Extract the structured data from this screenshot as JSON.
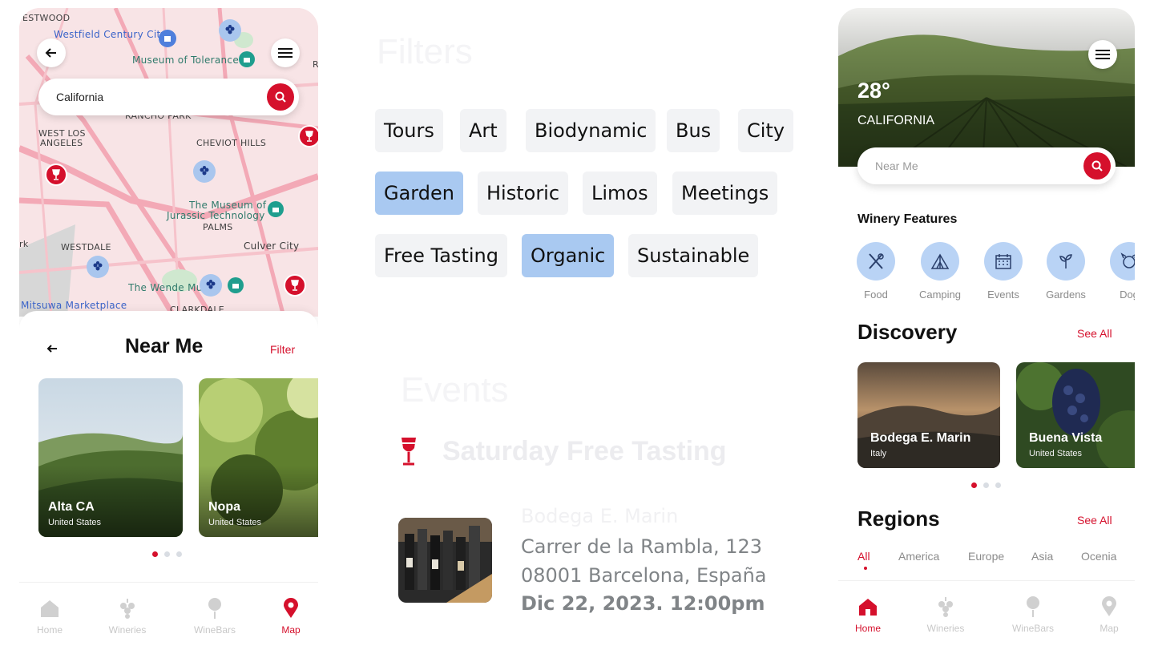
{
  "colors": {
    "accent": "#d5102c",
    "chip_selected": "#a9c9f1",
    "chip": "#f2f3f5",
    "feature_circle": "#b9d3f5"
  },
  "left_phone": {
    "map": {
      "search_value": "California",
      "labels": {
        "westwood": "ESTWOOD",
        "westfield": "Westfield Century City",
        "museum_tolerance": "Museum of Tolerance",
        "rancho_park": "RANCHO PARK",
        "west_la_1": "WEST LOS",
        "west_la_2": "ANGELES",
        "cheviot": "CHEVIOT HILLS",
        "jurassic_1": "The Museum of",
        "jurassic_2": "Jurassic Technology",
        "palms": "PALMS",
        "westdale": "WESTDALE",
        "culver": "Culver City",
        "rk": "rk",
        "wende": "The Wende Mu",
        "mitsuwa": "Mitsuwa Marketplace",
        "clarkdale": "CLARKDALE",
        "r_edge": "R"
      }
    },
    "sheet": {
      "title": "Near Me",
      "filter_label": "Filter",
      "cards": [
        {
          "title": "Alta CA",
          "subtitle": "United States"
        },
        {
          "title": "Nopa",
          "subtitle": "United States"
        }
      ]
    },
    "tabs": [
      {
        "label": "Home",
        "icon": "home-icon"
      },
      {
        "label": "Wineries",
        "icon": "grape-icon"
      },
      {
        "label": "WineBars",
        "icon": "wine-glass-pin-icon"
      },
      {
        "label": "Map",
        "icon": "map-pin-icon"
      }
    ]
  },
  "middle": {
    "filters_title": "Filters",
    "chips": [
      "Tours",
      "Art",
      "Biodynamic",
      "Bus",
      "City",
      "Garden",
      "Historic",
      "Limos",
      "Meetings",
      "Free Tasting",
      "Organic",
      "Sustainable"
    ],
    "selected_chips": [
      "Garden",
      "Organic"
    ],
    "events_title": "Events",
    "event": {
      "title": "Saturday Free Tasting",
      "venue": "Bodega E. Marin",
      "address1": "Carrer de la Rambla, 123",
      "address2": "08001 Barcelona, España",
      "datetime": "Dic 22, 2023. 12:00pm"
    }
  },
  "right_phone": {
    "temperature": "28°",
    "location": "CALIFORNIA",
    "search_placeholder": "Near Me",
    "features_title": "Winery Features",
    "features": [
      {
        "label": "Food",
        "icon": "utensils-icon"
      },
      {
        "label": "Camping",
        "icon": "tent-icon"
      },
      {
        "label": "Events",
        "icon": "calendar-icon"
      },
      {
        "label": "Gardens",
        "icon": "plant-icon"
      },
      {
        "label": "Dog",
        "icon": "dog-icon"
      }
    ],
    "discovery_title": "Discovery",
    "see_all": "See All",
    "discovery_cards": [
      {
        "title": "Bodega E. Marin",
        "subtitle": "Italy"
      },
      {
        "title": "Buena Vista",
        "subtitle": "United States"
      }
    ],
    "regions_title": "Regions",
    "regions": [
      "All",
      "America",
      "Europe",
      "Asia",
      "Ocenia"
    ],
    "tabs": [
      {
        "label": "Home",
        "icon": "home-icon"
      },
      {
        "label": "Wineries",
        "icon": "grape-icon"
      },
      {
        "label": "WineBars",
        "icon": "wine-glass-pin-icon"
      },
      {
        "label": "Map",
        "icon": "map-pin-icon"
      }
    ]
  }
}
